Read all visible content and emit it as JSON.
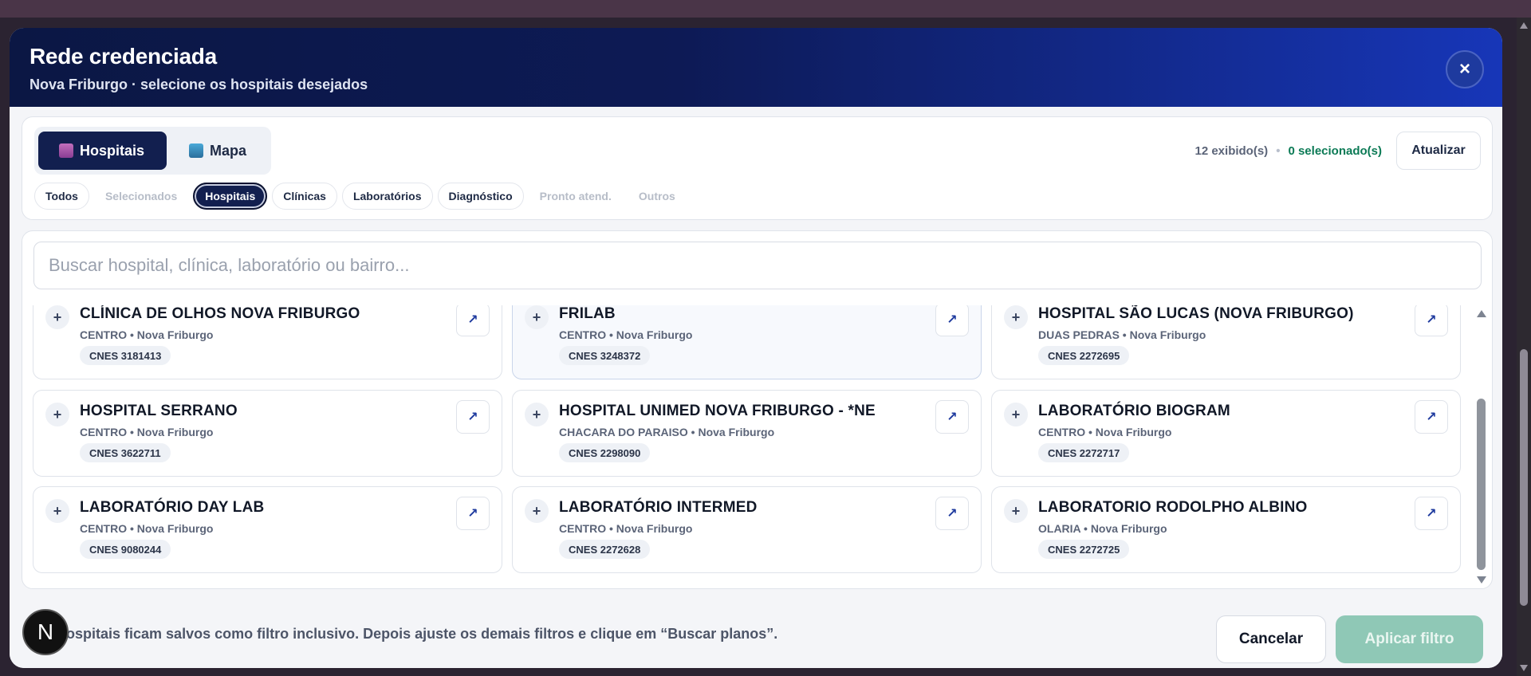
{
  "modal": {
    "title": "Rede credenciada",
    "subtitle": "Nova Friburgo · selecione os hospitais desejados",
    "close_icon": "×"
  },
  "view_toggle": {
    "items": [
      {
        "label": "Hospitais",
        "icon": "hospital-icon",
        "active": true
      },
      {
        "label": "Mapa",
        "icon": "map-icon",
        "active": false
      }
    ]
  },
  "counts": {
    "shown": "12 exibido(s)",
    "separator": "•",
    "selected": "0 selecionado(s)"
  },
  "refresh_label": "Atualizar",
  "chips": [
    {
      "label": "Todos",
      "state": "normal"
    },
    {
      "label": "Selecionados",
      "state": "disabled"
    },
    {
      "label": "Hospitais",
      "state": "active"
    },
    {
      "label": "Clínicas",
      "state": "normal"
    },
    {
      "label": "Laboratórios",
      "state": "normal"
    },
    {
      "label": "Diagnóstico",
      "state": "normal"
    },
    {
      "label": "Pronto atend.",
      "state": "disabled"
    },
    {
      "label": "Outros",
      "state": "disabled"
    }
  ],
  "search": {
    "placeholder": "Buscar hospital, clínica, laboratório ou bairro...",
    "value": ""
  },
  "cards": [
    {
      "name": "CLÍNICA DE OLHOS NOVA FRIBURGO",
      "location": "CENTRO • Nova Friburgo",
      "cnes": "CNES 3181413"
    },
    {
      "name": "FRILAB",
      "location": "CENTRO • Nova Friburgo",
      "cnes": "CNES 3248372"
    },
    {
      "name": "HOSPITAL SÃO LUCAS (NOVA FRIBURGO)",
      "location": "DUAS PEDRAS • Nova Friburgo",
      "cnes": "CNES 2272695"
    },
    {
      "name": "HOSPITAL SERRANO",
      "location": "CENTRO • Nova Friburgo",
      "cnes": "CNES 3622711"
    },
    {
      "name": "HOSPITAL UNIMED NOVA FRIBURGO - *NE",
      "location": "CHACARA DO PARAISO • Nova Friburgo",
      "cnes": "CNES 2298090"
    },
    {
      "name": "LABORATÓRIO BIOGRAM",
      "location": "CENTRO • Nova Friburgo",
      "cnes": "CNES 2272717"
    },
    {
      "name": "LABORATÓRIO DAY LAB",
      "location": "CENTRO • Nova Friburgo",
      "cnes": "CNES 9080244"
    },
    {
      "name": "LABORATÓRIO INTERMED",
      "location": "CENTRO • Nova Friburgo",
      "cnes": "CNES 2272628"
    },
    {
      "name": "LABORATORIO RODOLPHO ALBINO",
      "location": "OLARIA • Nova Friburgo",
      "cnes": "CNES 2272725"
    }
  ],
  "card_add_symbol": "+",
  "card_open_symbol": "↗",
  "footer": {
    "note": "Hospitais ficam salvos como filtro inclusivo. Depois ajuste os demais filtros e clique em “Buscar planos”.",
    "cancel_label": "Cancelar",
    "apply_label": "Aplicar filtro"
  },
  "next_badge": "N",
  "colors": {
    "header_dark": "#0b1744",
    "header_accent": "#1736b8",
    "active_chip": "#121f4f",
    "selected_count": "#0b7a55",
    "apply_button": "#8fc8b6"
  }
}
